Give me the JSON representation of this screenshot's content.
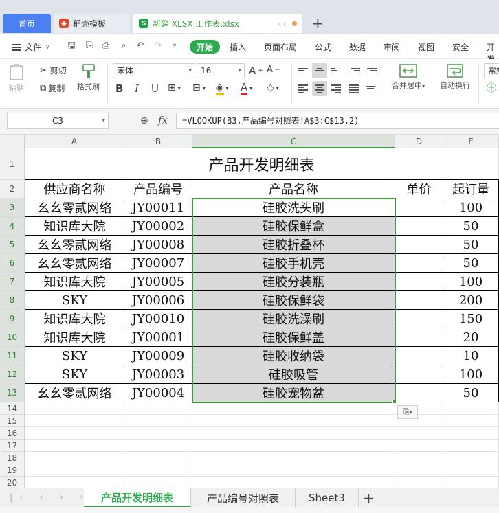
{
  "tabs": {
    "home": "首页",
    "docer": "稻壳模板",
    "file": "新建 XLSX 工作表.xlsx"
  },
  "menu": {
    "file": "文件",
    "start": "开始",
    "items": [
      "插入",
      "页面布局",
      "公式",
      "数据",
      "审阅",
      "视图",
      "安全",
      "开发"
    ]
  },
  "ribbon": {
    "paste": "粘贴",
    "cut": "剪切",
    "copy": "复制",
    "format_painter": "格式刷",
    "font_name": "宋体",
    "font_size": "16",
    "merge_center": "合并居中",
    "wrap_text": "自动换行",
    "number_format": "常规"
  },
  "formula_bar": {
    "name_box": "C3",
    "fx": "fx",
    "formula": "=VLOOKUP(B3,产品编号对照表!A$3:C$13,2)"
  },
  "columns": [
    "A",
    "B",
    "C",
    "D",
    "E"
  ],
  "rows": [
    "1",
    "2",
    "3",
    "4",
    "5",
    "6",
    "7",
    "8",
    "9",
    "10",
    "11",
    "12",
    "13",
    "14",
    "15",
    "16",
    "17",
    "18",
    "19",
    "20"
  ],
  "table": {
    "title": "产品开发明细表",
    "headers": [
      "供应商名称",
      "产品编号",
      "产品名称",
      "单价",
      "起订量"
    ],
    "rows": [
      [
        "幺幺零贰网络",
        "JY00011",
        "硅胶洗头刷",
        "",
        "100"
      ],
      [
        "知识库大院",
        "JY00002",
        "硅胶保鲜盒",
        "",
        "50"
      ],
      [
        "幺幺零贰网络",
        "JY00008",
        "硅胶折叠杯",
        "",
        "50"
      ],
      [
        "幺幺零贰网络",
        "JY00007",
        "硅胶手机壳",
        "",
        "50"
      ],
      [
        "知识库大院",
        "JY00005",
        "硅胶分装瓶",
        "",
        "100"
      ],
      [
        "SKY",
        "JY00006",
        "硅胶保鲜袋",
        "",
        "200"
      ],
      [
        "知识库大院",
        "JY00010",
        "硅胶洗澡刷",
        "",
        "150"
      ],
      [
        "知识库大院",
        "JY00001",
        "硅胶保鲜盖",
        "",
        "20"
      ],
      [
        "SKY",
        "JY00009",
        "硅胶收纳袋",
        "",
        "10"
      ],
      [
        "SKY",
        "JY00003",
        "硅胶吸管",
        "",
        "100"
      ],
      [
        "幺幺零贰网络",
        "JY00004",
        "硅胶宠物盆",
        "",
        "50"
      ]
    ]
  },
  "sheets": [
    "产品开发明细表",
    "产品编号对照表",
    "Sheet3"
  ],
  "active_sheet": "产品开发明细表",
  "colors": {
    "accent_green": "#2da94f",
    "selection_green": "#3c9b3c",
    "home_tab_blue": "#4b80f2",
    "cell_fill_gray": "#d9d9d9"
  }
}
